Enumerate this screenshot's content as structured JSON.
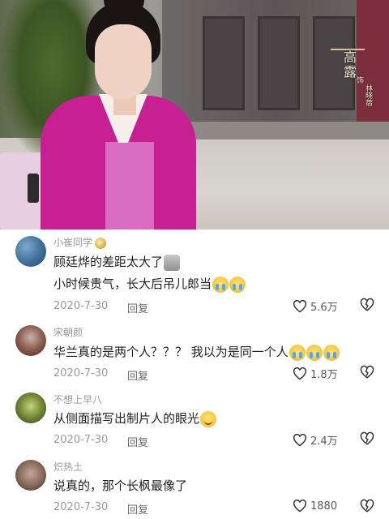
{
  "video": {
    "caption": {
      "name": "高露",
      "role": "饰",
      "actor": "林晓蓿"
    }
  },
  "comments": [
    {
      "username": "小崔同学",
      "lines": [
        "顾廷烨的差距太大了",
        "小时候贵气，长大后吊儿郎当"
      ],
      "emojis_line1": [
        "wolf"
      ],
      "emojis_line2": [
        "cry",
        "cry"
      ],
      "date": "2020-7-30",
      "reply_label": "回复",
      "likes": "5.6万"
    },
    {
      "username": "宋朝颜",
      "lines": [
        "华兰真的是两个人？？？ 我以为是同一个人"
      ],
      "emojis_line1": [
        "cry",
        "cry",
        "cry"
      ],
      "date": "2020-7-30",
      "reply_label": "回复",
      "likes": "1.8万"
    },
    {
      "username": "不想上早八",
      "lines": [
        "从侧面描写出制片人的眼光"
      ],
      "emojis_line1": [
        "smile"
      ],
      "date": "2020-7-30",
      "reply_label": "回复",
      "likes": "2.4万"
    },
    {
      "username": "炽热土",
      "lines": [
        "说真的，那个长枫最像了"
      ],
      "date": "2020-7-30",
      "reply_label": "回复",
      "likes": "1880"
    }
  ],
  "colors": {
    "text": "#1f1f1f",
    "meta": "#9a9a9a",
    "robe": "#c81f93"
  },
  "icons": [
    "heart-outline-icon",
    "broken-heart-icon",
    "badge-icon",
    "emoji-icon"
  ]
}
